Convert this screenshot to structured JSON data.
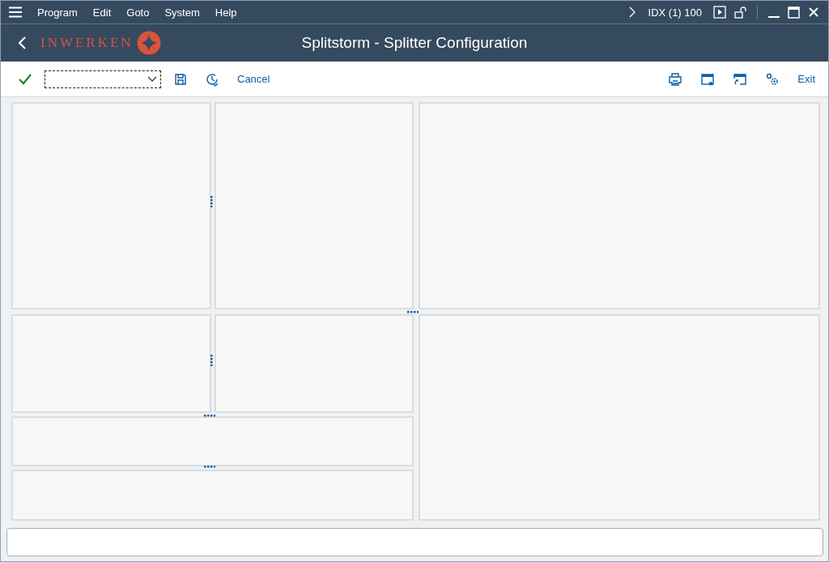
{
  "menu_bar": {
    "items": [
      "Program",
      "Edit",
      "Goto",
      "System",
      "Help"
    ],
    "system_info": "IDX (1) 100"
  },
  "title_bar": {
    "logo_text": "INWERKEN",
    "title": "Splitstorm - Splitter Configuration"
  },
  "toolbar": {
    "left_buttons": [
      {
        "kind": "icon"
      },
      {
        "kind": "icon"
      },
      {
        "kind": "text",
        "label": "Cancel"
      }
    ],
    "right_buttons": [
      {
        "kind": "icon"
      },
      {
        "kind": "icon"
      },
      {
        "kind": "icon"
      },
      {
        "kind": "icon"
      },
      {
        "kind": "text",
        "label": "Exit"
      }
    ]
  }
}
